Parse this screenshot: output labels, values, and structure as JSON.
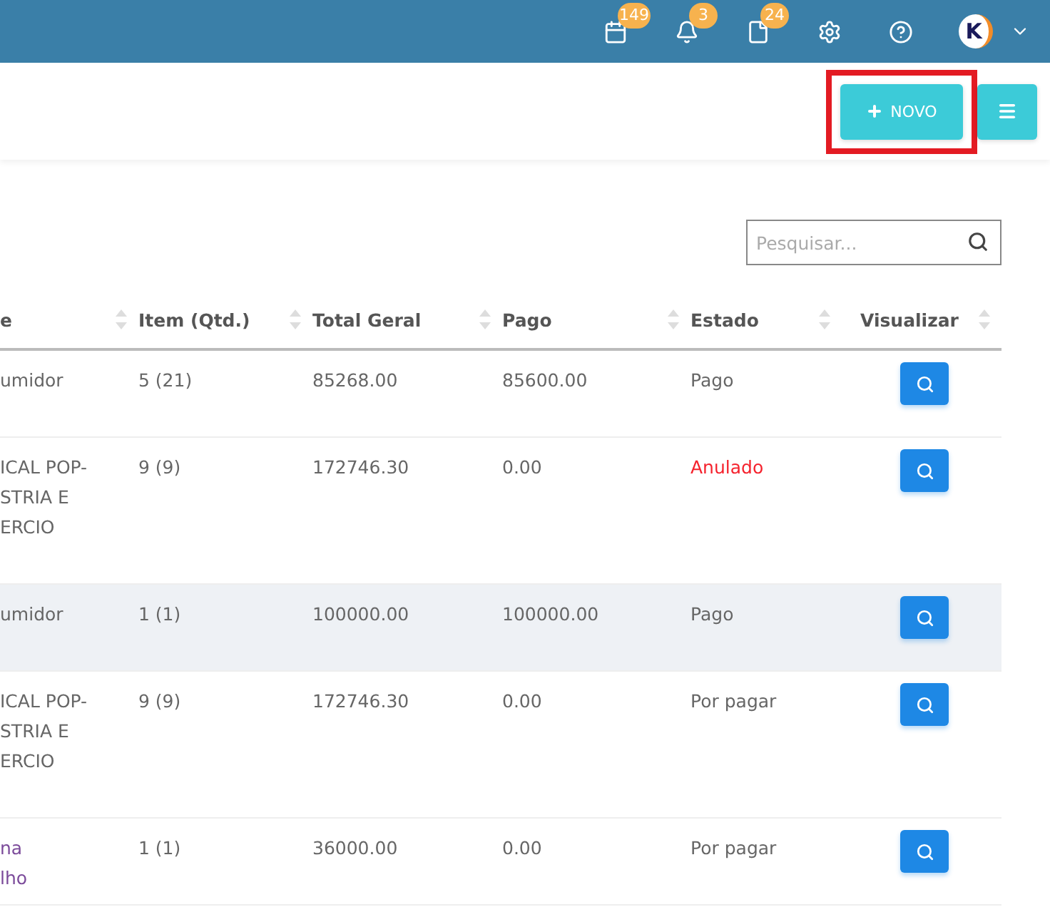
{
  "topbar": {
    "icons": [
      {
        "kind": "calendar",
        "badge": "149"
      },
      {
        "kind": "bell",
        "badge": "3"
      },
      {
        "kind": "document",
        "badge": "24"
      },
      {
        "kind": "settings"
      },
      {
        "kind": "help"
      }
    ],
    "avatar": {
      "letter": "K"
    }
  },
  "toolbar": {
    "new_button": {
      "label": "NOVO",
      "highlighted": true
    }
  },
  "search": {
    "placeholder": "Pesquisar..."
  },
  "table": {
    "columns": [
      "e",
      "Item (Qtd.)",
      "Total Geral",
      "Pago",
      "Estado",
      "Visualizar"
    ],
    "rows": [
      {
        "client": {
          "kind": "text",
          "lines": [
            "umidor"
          ]
        },
        "items": "5 (21)",
        "total": "85268.00",
        "paid": "85600.00",
        "status": {
          "kind": "normal",
          "text": "Pago"
        },
        "highlighted": false
      },
      {
        "client": {
          "kind": "text",
          "lines": [
            "ICAL POP-",
            "STRIA E",
            "ERCIO"
          ]
        },
        "items": "9 (9)",
        "total": "172746.30",
        "paid": "0.00",
        "status": {
          "kind": "cancelled",
          "text": "Anulado"
        },
        "highlighted": false
      },
      {
        "client": {
          "kind": "text",
          "lines": [
            "umidor"
          ]
        },
        "items": "1 (1)",
        "total": "100000.00",
        "paid": "100000.00",
        "status": {
          "kind": "normal",
          "text": "Pago"
        },
        "highlighted": true
      },
      {
        "client": {
          "kind": "text",
          "lines": [
            "ICAL POP-",
            "STRIA E",
            "ERCIO"
          ]
        },
        "items": "9 (9)",
        "total": "172746.30",
        "paid": "0.00",
        "status": {
          "kind": "normal",
          "text": "Por pagar"
        },
        "highlighted": false
      },
      {
        "client": {
          "kind": "link",
          "lines": [
            "na",
            "lho"
          ]
        },
        "items": "1 (1)",
        "total": "36000.00",
        "paid": "0.00",
        "status": {
          "kind": "normal",
          "text": "Por pagar"
        },
        "highlighted": false
      }
    ]
  }
}
